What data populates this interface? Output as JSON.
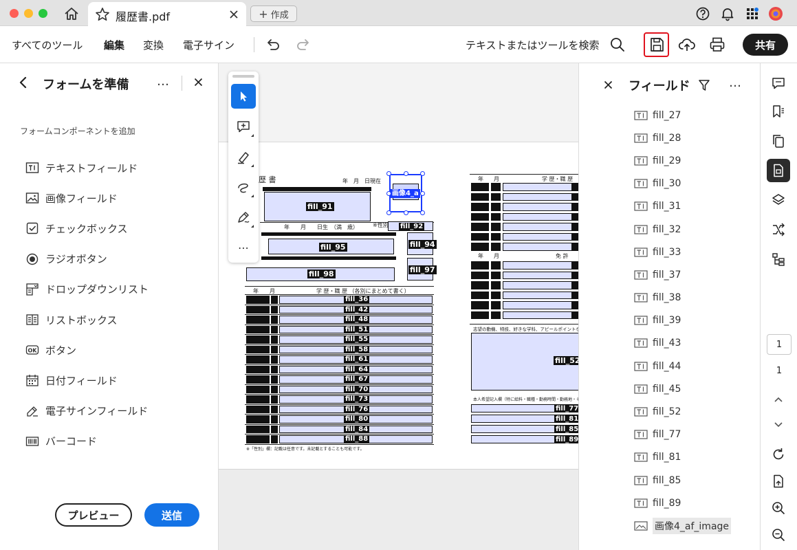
{
  "window": {
    "tab_title": "履歴書.pdf",
    "create_label": "作成"
  },
  "toolbar": {
    "menu": [
      "すべてのツール",
      "編集",
      "変換",
      "電子サイン"
    ],
    "active_menu": "編集",
    "search_label": "テキストまたはツールを検索",
    "share_label": "共有",
    "highlight_color": "#e0131e"
  },
  "left_panel": {
    "title": "フォームを準備",
    "more": "…",
    "subtitle": "フォームコンポーネントを追加",
    "components": [
      {
        "label": "テキストフィールド",
        "icon": "text-field-icon"
      },
      {
        "label": "画像フィールド",
        "icon": "image-field-icon"
      },
      {
        "label": "チェックボックス",
        "icon": "checkbox-icon"
      },
      {
        "label": "ラジオボタン",
        "icon": "radio-button-icon"
      },
      {
        "label": "ドロップダウンリスト",
        "icon": "dropdown-icon"
      },
      {
        "label": "リストボックス",
        "icon": "list-box-icon"
      },
      {
        "label": "ボタン",
        "icon": "ok-button-icon"
      },
      {
        "label": "日付フィールド",
        "icon": "calendar-icon"
      },
      {
        "label": "電子サインフィールド",
        "icon": "signature-icon"
      },
      {
        "label": "バーコード",
        "icon": "barcode-icon"
      }
    ],
    "preview_label": "プレビュー",
    "send_label": "送信"
  },
  "document": {
    "heading": "歴 書",
    "date_hint": "年　月　日現在",
    "labels": {
      "fill_91": "fill_91",
      "fill_92": "fill_92",
      "fill_94": "fill_94",
      "fill_95": "fill_95",
      "fill_97": "fill_97",
      "fill_98": "fill_98",
      "fill_52": "fill_52",
      "image": "画像4_a"
    },
    "row_labels_left": [
      "fill_36",
      "fill_42",
      "fill_48",
      "fill_51",
      "fill_55",
      "fill_58",
      "fill_61",
      "fill_64",
      "fill_67",
      "fill_70",
      "fill_73",
      "fill_76",
      "fill_80",
      "fill_84",
      "fill_88"
    ],
    "row_labels_right": [
      "fill_77",
      "fill_81",
      "fill_85",
      "fill_89"
    ],
    "birth_row": "年　　月　　日生　（満　歳）",
    "gender_label": "※性別",
    "education_header": "学 歴・職 歴 （各別にまとめて書く）",
    "right_header": "学 歴・職 歴",
    "license_header": "免 許",
    "motivation_label": "志望の動機、特技、好きな学科、アピールポイントなど",
    "request_label": "本人希望記入欄（特に給料・職種・勤務時間・勤務地・その他についての希望などがあれば記入）",
    "footnote": "※「性別」欄：記載は任意です。未記載とすることも可能です。",
    "year_col": "年",
    "month_col": "月"
  },
  "fields_panel": {
    "title": "フィールド",
    "more": "…",
    "fields": [
      {
        "label": "fill_27",
        "icon": "text-field-icon"
      },
      {
        "label": "fill_28",
        "icon": "text-field-icon"
      },
      {
        "label": "fill_29",
        "icon": "text-field-icon"
      },
      {
        "label": "fill_30",
        "icon": "text-field-icon"
      },
      {
        "label": "fill_31",
        "icon": "text-field-icon"
      },
      {
        "label": "fill_32",
        "icon": "text-field-icon"
      },
      {
        "label": "fill_33",
        "icon": "text-field-icon"
      },
      {
        "label": "fill_37",
        "icon": "text-field-icon"
      },
      {
        "label": "fill_38",
        "icon": "text-field-icon"
      },
      {
        "label": "fill_39",
        "icon": "text-field-icon"
      },
      {
        "label": "fill_43",
        "icon": "text-field-icon"
      },
      {
        "label": "fill_44",
        "icon": "text-field-icon"
      },
      {
        "label": "fill_45",
        "icon": "text-field-icon"
      },
      {
        "label": "fill_52",
        "icon": "text-field-icon"
      },
      {
        "label": "fill_77",
        "icon": "text-field-icon"
      },
      {
        "label": "fill_81",
        "icon": "text-field-icon"
      },
      {
        "label": "fill_85",
        "icon": "text-field-icon"
      },
      {
        "label": "fill_89",
        "icon": "text-field-icon"
      },
      {
        "label": "画像4_af_image",
        "icon": "image-field-icon",
        "selected": true
      }
    ]
  },
  "right_rail": {
    "page_current": "1",
    "page_total": "1"
  }
}
